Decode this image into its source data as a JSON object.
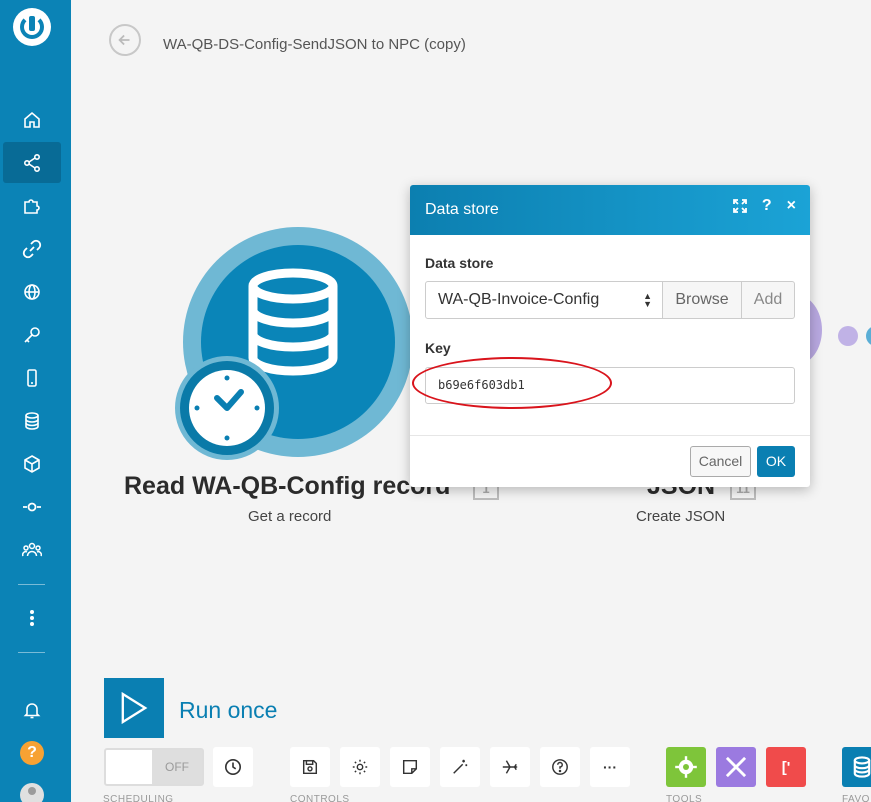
{
  "header": {
    "title": "WA-QB-DS-Config-SendJSON to NPC (copy)"
  },
  "sidebar": {
    "items": [
      {
        "icon": "home-icon"
      },
      {
        "icon": "share-icon",
        "active": true
      },
      {
        "icon": "puzzle-icon"
      },
      {
        "icon": "link-icon"
      },
      {
        "icon": "globe-icon"
      },
      {
        "icon": "key-icon"
      },
      {
        "icon": "mobile-icon"
      },
      {
        "icon": "database-icon"
      },
      {
        "icon": "box-icon"
      },
      {
        "icon": "flow-icon"
      },
      {
        "icon": "team-icon"
      },
      {
        "icon": "more-icon"
      },
      {
        "icon": "bell-icon"
      }
    ],
    "help_label": "?"
  },
  "modules": [
    {
      "title": "Read WA-QB-Config record",
      "badge": "1",
      "subtitle": "Get a record"
    },
    {
      "title": "JSON",
      "badge": "11",
      "subtitle": "Create JSON"
    }
  ],
  "dialog": {
    "title": "Data store",
    "data_store_label": "Data store",
    "data_store_value": "WA-QB-Invoice-Config",
    "browse_label": "Browse",
    "add_label": "Add",
    "key_label": "Key",
    "key_value": "b69e6f603db1",
    "cancel_label": "Cancel",
    "ok_label": "OK",
    "highlight_color": "#d9141c"
  },
  "toolbar": {
    "run_label": "Run once",
    "toggle_label": "OFF",
    "scheduling_label": "SCHEDULING",
    "controls_label": "CONTROLS",
    "tools_label": "TOOLS",
    "favorites_label": "FAVO",
    "more_label": "···"
  },
  "colors": {
    "accent": "#0a7fb2",
    "sidebar": "#0b83b6",
    "tool_green": "#7ec53a",
    "tool_purple": "#9b7ae0",
    "tool_red": "#f04b4b",
    "tool_blue": "#0a7fb2"
  }
}
